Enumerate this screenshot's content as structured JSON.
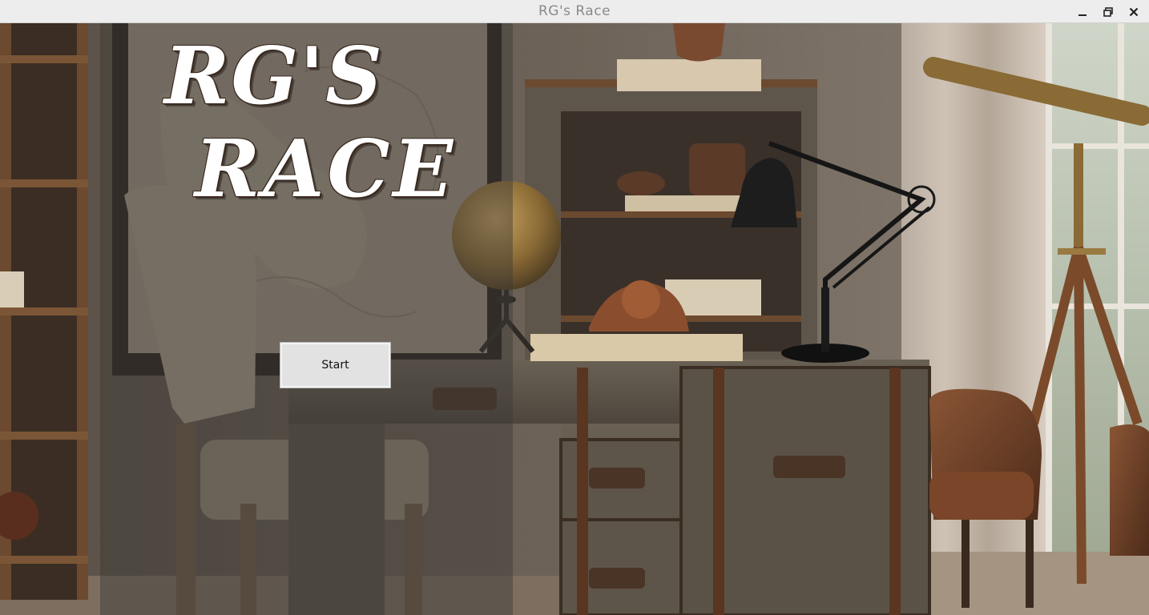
{
  "window": {
    "title": "RG's Race",
    "controls": {
      "minimize_icon": "minimize-icon",
      "maximize_icon": "maximize-icon",
      "close_icon": "close-icon"
    }
  },
  "game": {
    "title_line1": "RG'S",
    "title_line2": "RACE",
    "start_label": "Start"
  },
  "colors": {
    "titlebar_bg": "#ededed",
    "title_text": "#ffffff",
    "button_bg": "#e2e2e2"
  }
}
